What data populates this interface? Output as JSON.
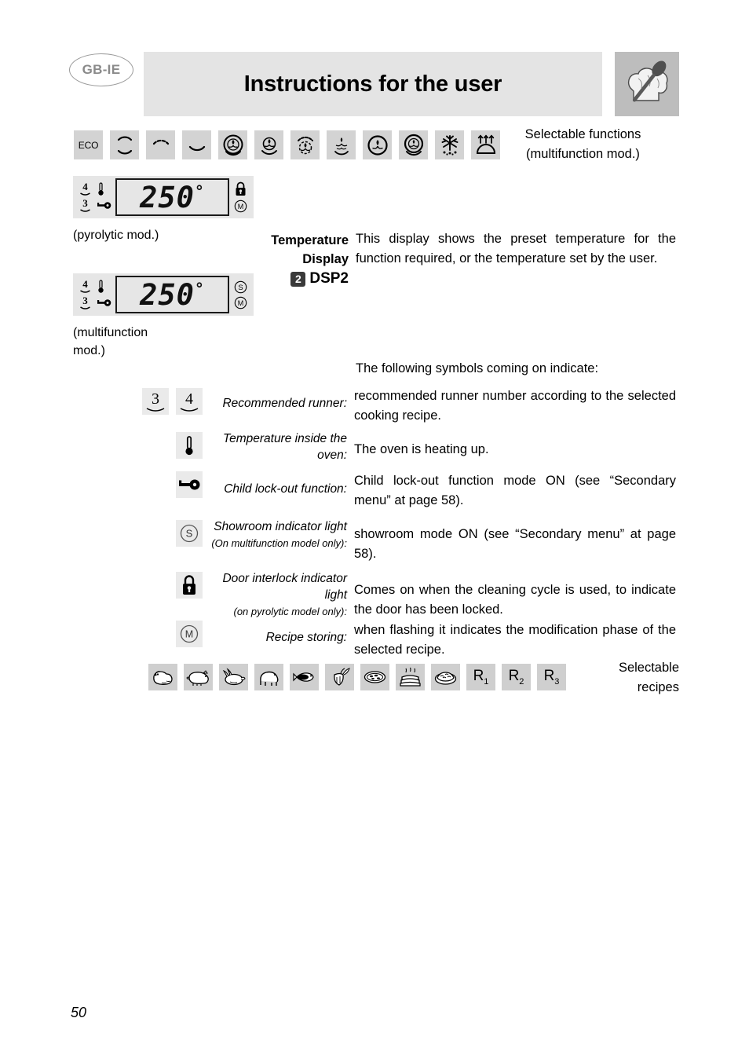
{
  "header": {
    "language_badge": "GB-IE",
    "title": "Instructions for the user",
    "logo_icon": "chef-hat-spoon-icon"
  },
  "functions": {
    "side_label_line1": "Selectable functions",
    "side_label_line2": "(multifunction mod.)",
    "items": [
      {
        "label": "ECO",
        "icon": "eco-text-icon"
      },
      {
        "label": "",
        "icon": "top-bottom-heat-icon"
      },
      {
        "label": "",
        "icon": "top-heat-grill-icon"
      },
      {
        "label": "",
        "icon": "bottom-heat-icon"
      },
      {
        "label": "",
        "icon": "circular-fan-full-icon"
      },
      {
        "label": "",
        "icon": "fan-bottom-heat-icon"
      },
      {
        "label": "",
        "icon": "fan-top-heat-icon"
      },
      {
        "label": "",
        "icon": "fan-grill-icon"
      },
      {
        "label": "",
        "icon": "fan-circle-icon"
      },
      {
        "label": "",
        "icon": "fan-circle-ring-icon"
      },
      {
        "label": "",
        "icon": "snowflake-defrost-icon"
      },
      {
        "label": "",
        "icon": "dome-rising-arrows-icon"
      }
    ]
  },
  "displays": {
    "pyrolytic": {
      "value": "250",
      "degree": "°",
      "runner_top": "4",
      "runner_bottom": "3",
      "left_icons": [
        "thermometer-icon",
        "key-icon"
      ],
      "right_icons": [
        "padlock-icon",
        "circled-m-icon"
      ],
      "caption": "(pyrolytic mod.)"
    },
    "multifunction": {
      "value": "250",
      "degree": "°",
      "runner_top": "4",
      "runner_bottom": "3",
      "left_icons": [
        "thermometer-icon",
        "key-icon"
      ],
      "right_icons": [
        "circled-s-icon",
        "circled-m-icon"
      ],
      "caption_line1": "(multifunction",
      "caption_line2": "mod.)"
    }
  },
  "dsp2": {
    "label_line1": "Temperature",
    "label_line2": "Display",
    "badge_number": "2",
    "code": "DSP2",
    "description": "This display shows the preset temperature for the function required, or the temperature set by the user."
  },
  "intro_line": "The following symbols coming on indicate:",
  "legend": [
    {
      "icons": [
        "runner-3-icon",
        "runner-4-icon"
      ],
      "icon_values": [
        "3",
        "4"
      ],
      "term": "Recommended runner:",
      "term_sub": "",
      "description": "recommended runner number according to the selected cooking recipe."
    },
    {
      "icons": [
        "thermometer-icon"
      ],
      "icon_values": [],
      "term": "Temperature inside the oven:",
      "term_sub": "",
      "description": "The oven is heating up."
    },
    {
      "icons": [
        "key-icon"
      ],
      "icon_values": [],
      "term": "Child lock-out function:",
      "term_sub": "",
      "description": "Child lock-out function mode ON (see “Secondary menu” at page 58)."
    },
    {
      "icons": [
        "circled-s-icon"
      ],
      "icon_values": [],
      "term": "Showroom indicator light",
      "term_sub": "(On multifunction model only):",
      "description": "showroom mode ON (see “Secondary menu” at page 58)."
    },
    {
      "icons": [
        "padlock-icon"
      ],
      "icon_values": [],
      "term": "Door interlock indicator light",
      "term_sub": "(on pyrolytic model only):",
      "description": "Comes on when the cleaning cycle is used, to indicate the door has been locked."
    },
    {
      "icons": [
        "circled-m-icon"
      ],
      "icon_values": [],
      "term": "Recipe storing:",
      "term_sub": "",
      "description": "when flashing it indicates the modification phase of the selected recipe."
    }
  ],
  "recipes": {
    "side_label_line1": "Selectable",
    "side_label_line2": "recipes",
    "items": [
      {
        "icon": "beef-icon",
        "label": ""
      },
      {
        "icon": "pork-icon",
        "label": ""
      },
      {
        "icon": "poultry-icon",
        "label": ""
      },
      {
        "icon": "lamb-icon",
        "label": ""
      },
      {
        "icon": "fish-icon",
        "label": ""
      },
      {
        "icon": "vegetables-icon",
        "label": ""
      },
      {
        "icon": "pizza-icon",
        "label": ""
      },
      {
        "icon": "cake-icon",
        "label": ""
      },
      {
        "icon": "bread-icon",
        "label": ""
      },
      {
        "icon": "recipe-r1-icon",
        "label": "R",
        "sub": "1"
      },
      {
        "icon": "recipe-r2-icon",
        "label": "R",
        "sub": "2"
      },
      {
        "icon": "recipe-r3-icon",
        "label": "R",
        "sub": "3"
      }
    ]
  },
  "footer": {
    "page_number": "50"
  },
  "colors": {
    "title_bar_bg": "#e4e4e4",
    "icon_cell_bg": "#d3d3d3",
    "legend_icon_bg": "#eaeaea",
    "recipe_cell_bg": "#cfcfcf",
    "badge_bg": "#3a3a3a",
    "text": "#000000"
  }
}
